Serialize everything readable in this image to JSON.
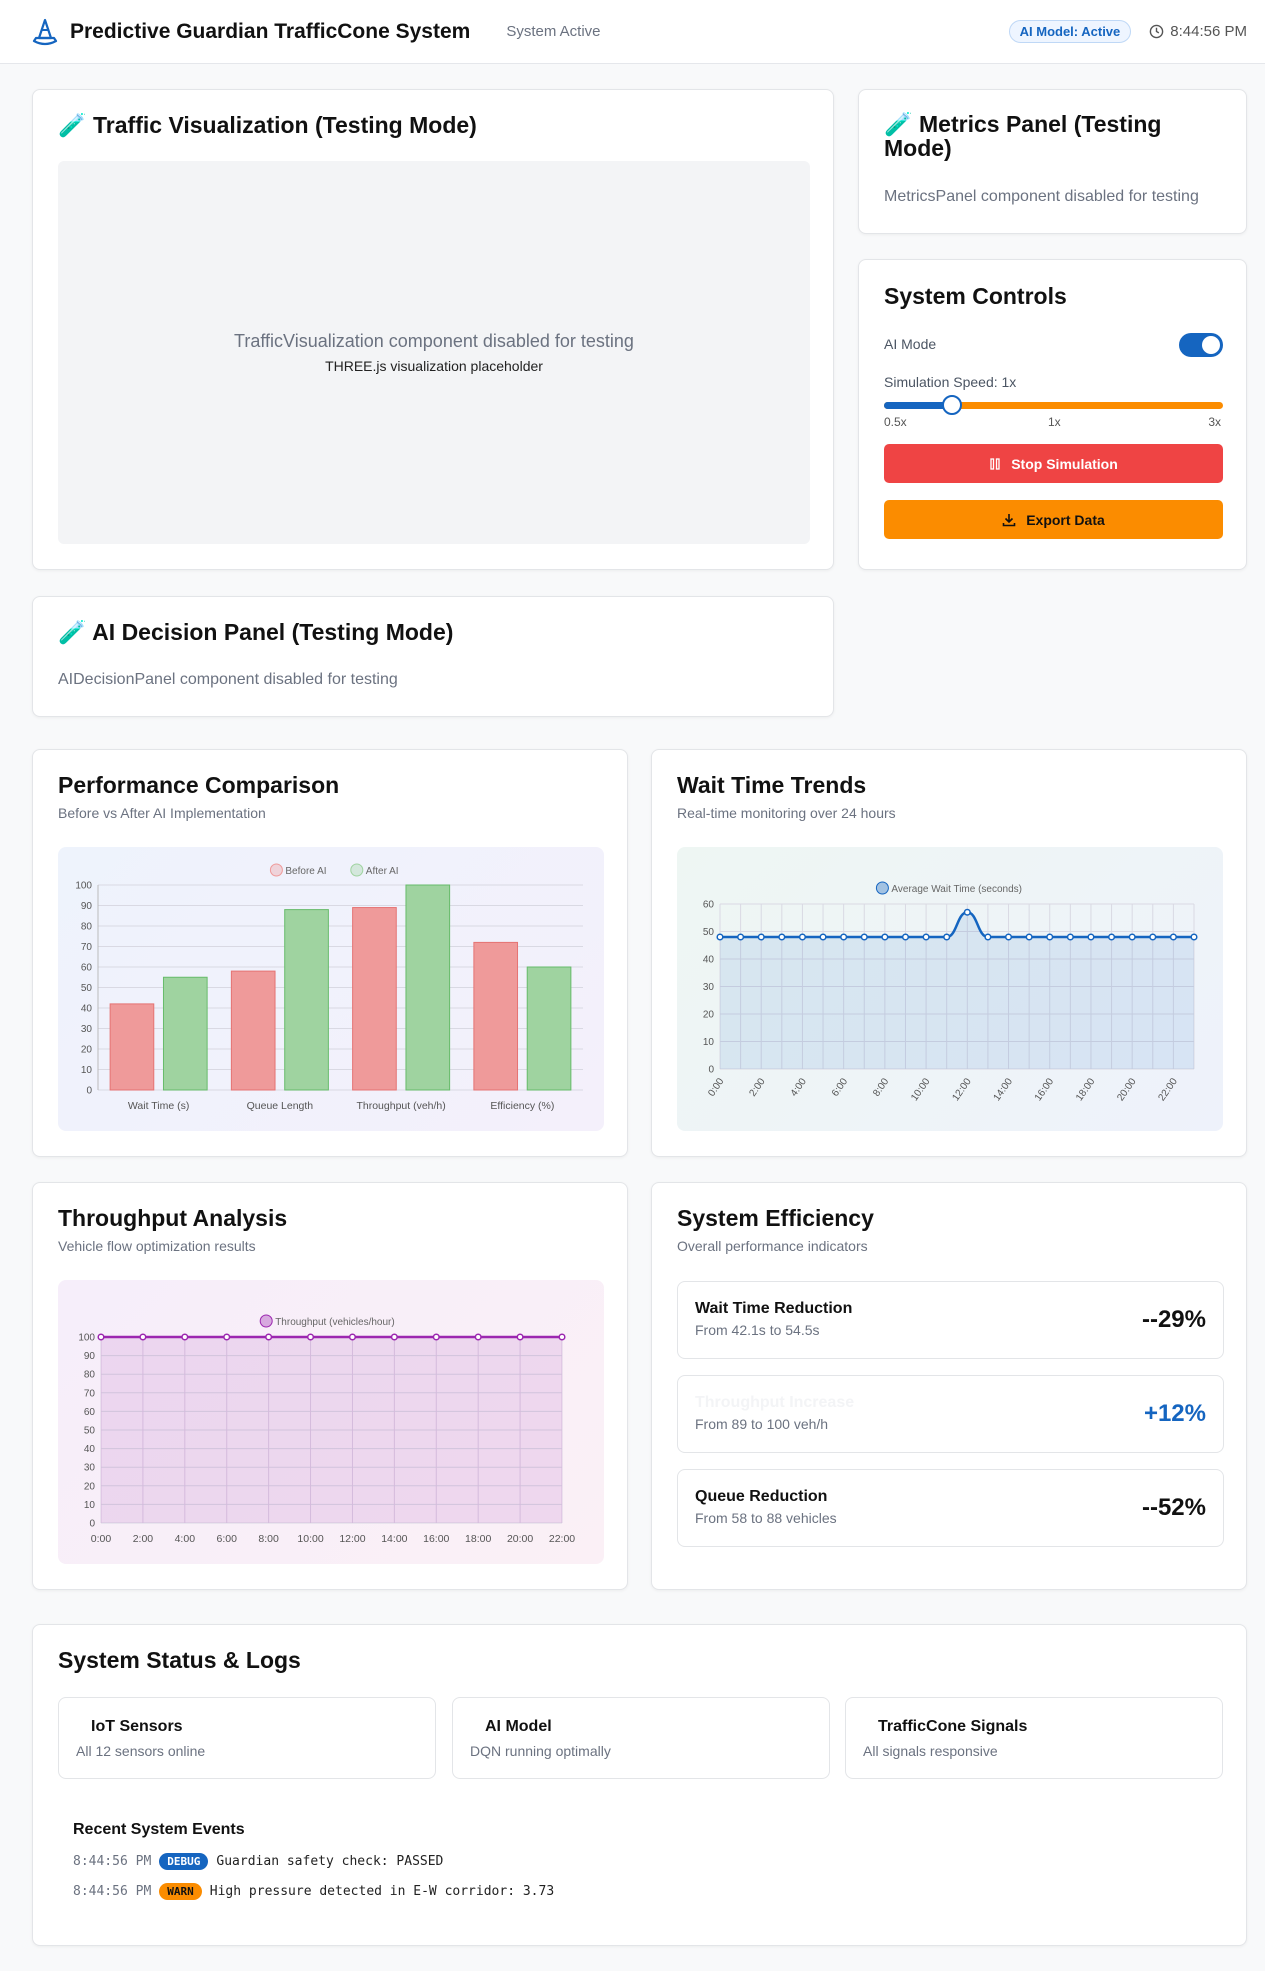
{
  "header": {
    "title": "Predictive Guardian TrafficCone System",
    "status": "System Active",
    "model_badge": "AI Model: Active",
    "time": "8:44:56 PM"
  },
  "traffic_viz": {
    "title": "🧪 Traffic Visualization (Testing Mode)",
    "placeholder_main": "TrafficVisualization component disabled for testing",
    "placeholder_sub": "THREE.js visualization placeholder"
  },
  "metrics_panel": {
    "title": "🧪 Metrics Panel (Testing Mode)",
    "message": "MetricsPanel component disabled for testing"
  },
  "controls": {
    "title": "System Controls",
    "ai_mode_label": "AI Mode",
    "ai_mode_on": true,
    "speed_label": "Simulation Speed: 1x",
    "speed_min": "0.5x",
    "speed_mid": "1x",
    "speed_max": "3x",
    "speed_fraction": 0.2,
    "stop_label": "Stop Simulation",
    "export_label": "Export Data"
  },
  "ai_decision": {
    "title": "🧪 AI Decision Panel (Testing Mode)",
    "message": "AIDecisionPanel component disabled for testing"
  },
  "perf": {
    "title": "Performance Comparison",
    "subtitle": "Before vs After AI Implementation"
  },
  "wait": {
    "title": "Wait Time Trends",
    "subtitle": "Real-time monitoring over 24 hours"
  },
  "throughput": {
    "title": "Throughput Analysis",
    "subtitle": "Vehicle flow optimization results"
  },
  "efficiency": {
    "title": "System Efficiency",
    "subtitle": "Overall performance indicators",
    "items": [
      {
        "title": "Wait Time Reduction",
        "sub": "From 42.1s to 54.5s",
        "value": "--29%",
        "color": "#111111"
      },
      {
        "title": "Throughput Increase",
        "sub": "From 89 to 100 veh/h",
        "value": "+12%",
        "color": "#1565c0"
      },
      {
        "title": "Queue Reduction",
        "sub": "From 58 to 88 vehicles",
        "value": "--52%",
        "color": "#111111"
      }
    ]
  },
  "status": {
    "title": "System Status & Logs",
    "boxes": [
      {
        "title": "IoT Sensors",
        "sub": "All 12 sensors online"
      },
      {
        "title": "AI Model",
        "sub": "DQN running optimally"
      },
      {
        "title": "TrafficCone Signals",
        "sub": "All signals responsive"
      }
    ],
    "events_title": "Recent System Events",
    "events": [
      {
        "time": "8:44:56 PM",
        "level": "DEBUG",
        "message": "Guardian safety check: PASSED"
      },
      {
        "time": "8:44:56 PM",
        "level": "WARN",
        "message": "High pressure detected in E-W corridor: 3.73"
      }
    ]
  },
  "chart_data": [
    {
      "type": "bar",
      "categories": [
        "Wait Time (s)",
        "Queue Length",
        "Throughput (veh/h)",
        "Efficiency (%)"
      ],
      "series": [
        {
          "name": "Before AI",
          "values": [
            42,
            58,
            89,
            72
          ],
          "color": "#ef9a9a"
        },
        {
          "name": "After AI",
          "values": [
            55,
            88,
            100,
            60
          ],
          "color": "#9fd3a0"
        }
      ],
      "ylim": [
        0,
        100
      ],
      "yticks": [
        0,
        10,
        20,
        30,
        40,
        50,
        60,
        70,
        80,
        90,
        100
      ],
      "legend": "top"
    },
    {
      "type": "area",
      "x": [
        "0:00",
        "1:00",
        "2:00",
        "3:00",
        "4:00",
        "5:00",
        "6:00",
        "7:00",
        "8:00",
        "9:00",
        "10:00",
        "11:00",
        "12:00",
        "13:00",
        "14:00",
        "15:00",
        "16:00",
        "17:00",
        "18:00",
        "19:00",
        "20:00",
        "21:00",
        "22:00",
        "23:00"
      ],
      "xticks": [
        "0:00",
        "2:00",
        "4:00",
        "6:00",
        "8:00",
        "10:00",
        "12:00",
        "14:00",
        "16:00",
        "18:00",
        "20:00",
        "22:00"
      ],
      "series": [
        {
          "name": "Average Wait Time (seconds)",
          "values": [
            48,
            48,
            48,
            48,
            48,
            48,
            48,
            48,
            48,
            48,
            48,
            48,
            57,
            48,
            48,
            48,
            48,
            48,
            48,
            48,
            48,
            48,
            48,
            48
          ],
          "color": "#1565c0"
        }
      ],
      "ylim": [
        0,
        60
      ],
      "yticks": [
        0,
        10,
        20,
        30,
        40,
        50,
        60
      ],
      "legend": "top"
    },
    {
      "type": "area",
      "x": [
        "0:00",
        "2:00",
        "4:00",
        "6:00",
        "8:00",
        "10:00",
        "12:00",
        "14:00",
        "16:00",
        "18:00",
        "20:00",
        "22:00"
      ],
      "series": [
        {
          "name": "Throughput (vehicles/hour)",
          "values": [
            100,
            100,
            100,
            100,
            100,
            100,
            100,
            100,
            100,
            100,
            100,
            100
          ],
          "color": "#9c27b0"
        }
      ],
      "ylim": [
        0,
        100
      ],
      "yticks": [
        0,
        10,
        20,
        30,
        40,
        50,
        60,
        70,
        80,
        90,
        100
      ],
      "legend": "top"
    }
  ]
}
